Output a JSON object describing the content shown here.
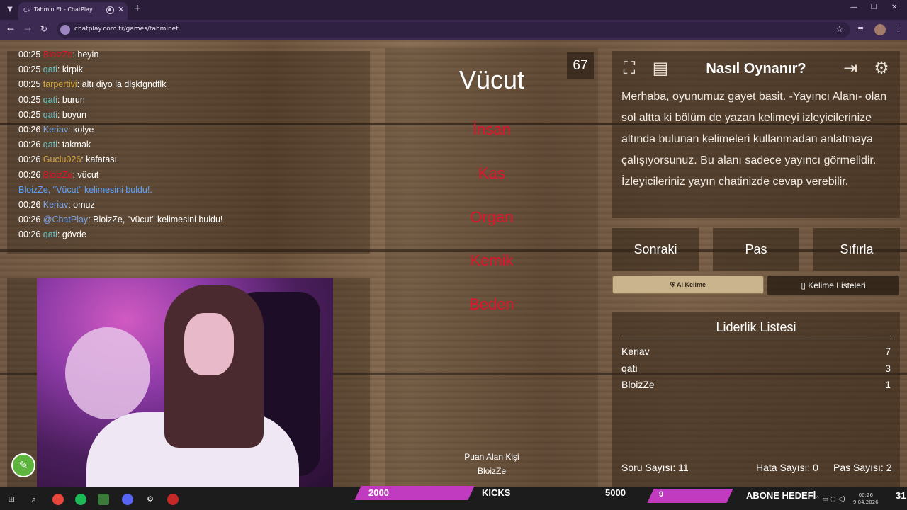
{
  "browser": {
    "tab_favicon": "CP",
    "tab_title": "Tahmin Et - ChatPlay",
    "tab_close": "✕",
    "new_tab": "+",
    "url": "chatplay.com.tr/games/tahminet",
    "win_min": "—",
    "win_restore": "❐",
    "win_close": "✕"
  },
  "chat": [
    {
      "time": "00:25",
      "user": "BloizZe",
      "color": "#e0142a",
      "msg": ": beyin"
    },
    {
      "time": "00:25",
      "user": "qati",
      "color": "#6fc3c3",
      "msg": ": kirpik"
    },
    {
      "time": "00:25",
      "user": "tarpertivi",
      "color": "#d4a93c",
      "msg": ": altı diyo la dlşkfgndflk"
    },
    {
      "time": "00:25",
      "user": "qati",
      "color": "#6fc3c3",
      "msg": ": burun"
    },
    {
      "time": "00:25",
      "user": "qati",
      "color": "#6fc3c3",
      "msg": ": boyun"
    },
    {
      "time": "00:26",
      "user": "Keriav",
      "color": "#7aa3e8",
      "msg": ": kolye"
    },
    {
      "time": "00:26",
      "user": "qati",
      "color": "#6fc3c3",
      "msg": ": takmak"
    },
    {
      "time": "00:26",
      "user": "Guclu026",
      "color": "#d4a93c",
      "msg": ": kafatası"
    },
    {
      "time": "00:26",
      "user": "BloizZe",
      "color": "#e0142a",
      "msg": ": vücut"
    },
    {
      "system": "BloizZe, \"Vücut\" kelimesini buldu!."
    },
    {
      "time": "00:26",
      "user": "Keriav",
      "color": "#7aa3e8",
      "msg": ": omuz"
    },
    {
      "time": "00:26",
      "user": "@ChatPlay",
      "color": "#7aa3e8",
      "msg": ": BloizZe, \"vücut\" kelimesini buldu!"
    },
    {
      "time": "00:26",
      "user": "qati",
      "color": "#6fc3c3",
      "msg": ": gövde"
    }
  ],
  "game": {
    "timer": "67",
    "word": "Vücut",
    "taboo_words": [
      "İnsan",
      "Kas",
      "Organ",
      "Kemik",
      "Beden"
    ],
    "scorer_label": "Puan Alan Kişi",
    "scorer_name": "BloizZe"
  },
  "howto": {
    "title": "Nasıl Oynanır?",
    "text": "Merhaba, oyunumuz gayet basit. -Yayıncı Alanı- olan sol altta ki bölüm de yazan kelimeyi izleyicilerinize altında bulunan kelimeleri kullanmadan anlatmaya çalışıyorsunuz. Bu alanı sadece yayıncı görmelidir. İzleyicileriniz yayın chatinizde cevap verebilir."
  },
  "actions": {
    "next": "Sonraki",
    "pass": "Pas",
    "reset": "Sıfırla",
    "ai_word": "AI Kelime",
    "word_lists": "Kelime Listeleri"
  },
  "leaderboard": {
    "title": "Liderlik Listesi",
    "rows": [
      {
        "name": "Keriav",
        "score": "7"
      },
      {
        "name": "qati",
        "score": "3"
      },
      {
        "name": "BloizZe",
        "score": "1"
      }
    ],
    "question_count": "Soru Sayısı: 11",
    "error_count": "Hata Sayısı: 0",
    "pass_count": "Pas Sayısı: 2"
  },
  "overlay": {
    "kicks_value": "2000",
    "kicks_label": "KICKS",
    "kicks_goal": "5000",
    "sub_value": "9",
    "sub_label": "ABONE HEDEFİ",
    "clock_time": "00:26",
    "clock_date": "9.04.2026",
    "day": "31"
  },
  "colors": {
    "accent_pink": "#c03bbf",
    "taboo_red": "#e0142a",
    "system_msg": "#5aa0ff",
    "ai_button": "#c9b48d"
  }
}
